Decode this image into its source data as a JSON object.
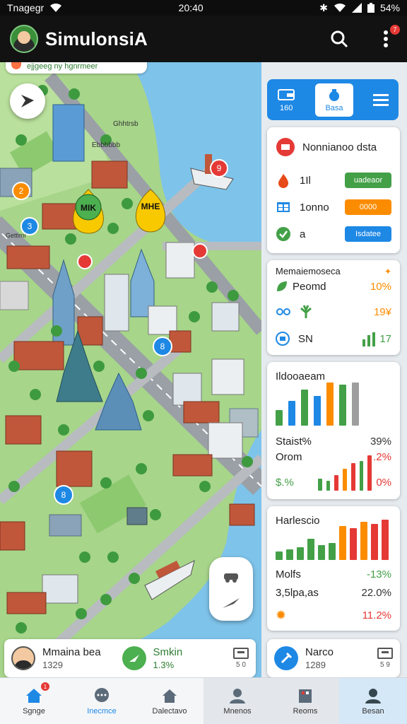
{
  "status_bar": {
    "carrier": "Tnagegr",
    "time": "20:40",
    "battery": "54%"
  },
  "app_bar": {
    "title": "SimulonsiA",
    "notification_count": "7"
  },
  "map": {
    "banner_text": "ejjgeeg ny hgnrmeer",
    "labels": {
      "m1": "MIK",
      "m2": "MHE",
      "m3": "Ebbbbbb",
      "m4": "Ghhtrsb",
      "m5": "Gettimr"
    },
    "markers": {
      "p1": "2",
      "p2": "3",
      "p3": "8",
      "p4": "9",
      "p5": "8"
    }
  },
  "map_cards": [
    {
      "name": "Mmaina bea",
      "value": "1329",
      "icon": "avatar-icon",
      "num": "5 0"
    },
    {
      "name": "Smkin",
      "value": "1.3%",
      "icon": "green-badge-icon",
      "num": ""
    }
  ],
  "panel": {
    "toolbar": {
      "item1": "160",
      "item2": "Basa"
    },
    "card1": {
      "title": "Nonnianoo dsta",
      "rows": [
        {
          "label": "1Il",
          "pill": "uadeaor",
          "pill_color": "#43a047"
        },
        {
          "label": "1onno",
          "pill": "0000",
          "pill_color": "#fb8c00"
        },
        {
          "label": "a",
          "pill": "Isdatee",
          "pill_color": "#1e88e5"
        }
      ]
    },
    "card2": {
      "title": "Memaiemoseca",
      "rows": [
        {
          "label": "Peomd",
          "value": "10%"
        },
        {
          "label": "",
          "value": "19¥"
        },
        {
          "label": "SN",
          "value": "17"
        }
      ]
    },
    "card3": {
      "title": "Ildooaeam",
      "stat_label": "Staist%",
      "stat_value": "39%",
      "row2_label": "Orom",
      "row2_value": ".2%",
      "row3_label": "$.%",
      "row3_value": "0%",
      "bars_top": [
        0.35,
        0.55,
        0.8,
        0.65,
        0.95,
        0.9,
        0.95
      ],
      "bars_top_colors": [
        "#43a047",
        "#1e88e5",
        "#43a047",
        "#1e88e5",
        "#fb8c00",
        "#43a047",
        "#9e9e9e"
      ],
      "bars_bottom": [
        0.3,
        0.25,
        0.4,
        0.55,
        0.7,
        0.75,
        0.9
      ],
      "bars_bottom_colors": [
        "#43a047",
        "#43a047",
        "#e53935",
        "#fb8c00",
        "#e53935",
        "#43a047",
        "#e53935"
      ]
    },
    "card4": {
      "title": "Harlescio",
      "rows": [
        {
          "label": "Molfs",
          "value": "-13%"
        },
        {
          "label": "3,5lpa,as",
          "value": "22.0%"
        },
        {
          "label": "",
          "value": "11.2%"
        }
      ],
      "bars": [
        0.2,
        0.25,
        0.3,
        0.5,
        0.35,
        0.4,
        0.8,
        0.75,
        0.9,
        0.85,
        0.95
      ],
      "bar_colors": [
        "#43a047",
        "#43a047",
        "#43a047",
        "#43a047",
        "#43a047",
        "#43a047",
        "#fb8c00",
        "#e53935",
        "#fb8c00",
        "#e53935",
        "#e53935"
      ]
    },
    "card5": {
      "name": "Narco",
      "value": "1289",
      "num": "5 9"
    }
  },
  "bottom_nav": [
    {
      "label": "Sgnge",
      "icon": "home-icon",
      "badge": "1"
    },
    {
      "label": "Inecmce",
      "icon": "chat-icon"
    },
    {
      "label": "Dalectavo",
      "icon": "building-icon"
    },
    {
      "label": "Mnenos",
      "icon": "people-icon"
    },
    {
      "label": "Reoms",
      "icon": "store-icon"
    },
    {
      "label": "Besan",
      "icon": "person-icon"
    }
  ]
}
